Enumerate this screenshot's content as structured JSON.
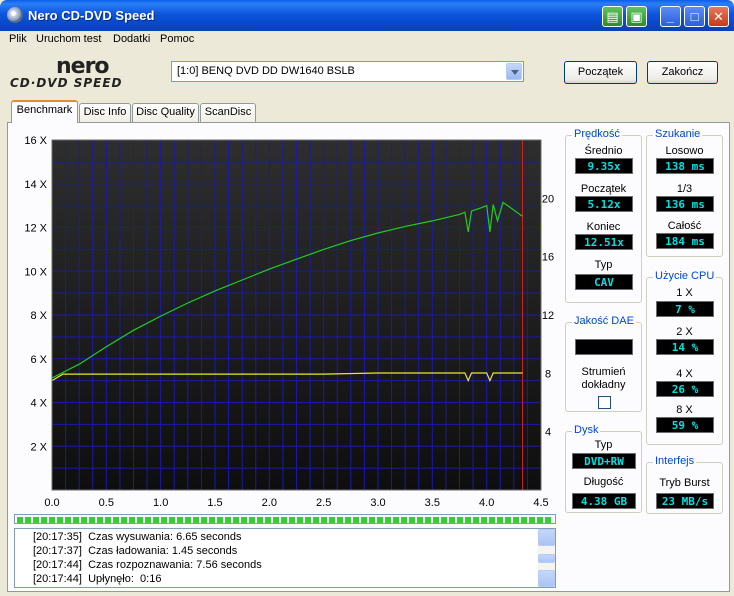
{
  "window": {
    "title": "Nero CD-DVD Speed"
  },
  "menu": [
    "Plik",
    "Uruchom test",
    "Dodatki",
    "Pomoc"
  ],
  "logo": {
    "brand": "nero",
    "product": "CD·DVD SPEED"
  },
  "drive": {
    "selected": "[1:0]  BENQ DVD DD DW1640 BSLB"
  },
  "buttons": {
    "start": "Początek",
    "stop": "Zakończ"
  },
  "tabs": [
    {
      "label": "Benchmark",
      "active": true
    },
    {
      "label": "Disc Info",
      "active": false
    },
    {
      "label": "Disc Quality",
      "active": false
    },
    {
      "label": "ScanDisc",
      "active": false
    }
  ],
  "speed_group": {
    "title": "Prędkość",
    "average_label": "Średnio",
    "average": "9.35x",
    "start_label": "Początek",
    "start": "5.12x",
    "end_label": "Koniec",
    "end": "12.51x",
    "type_label": "Typ",
    "type": "CAV"
  },
  "seek_group": {
    "title": "Szukanie",
    "random_label": "Losowo",
    "random": "138 ms",
    "third_label": "1/3",
    "third": "136 ms",
    "full_label": "Całość",
    "full": "184 ms"
  },
  "dae_group": {
    "title": "Jakość DAE",
    "value": "",
    "stream_label_1": "Strumień",
    "stream_label_2": "dokładny"
  },
  "cpu_group": {
    "title": "Użycie CPU",
    "rows": [
      {
        "label": "1 X",
        "value": "7 %"
      },
      {
        "label": "2 X",
        "value": "14 %"
      },
      {
        "label": "4 X",
        "value": "26 %"
      },
      {
        "label": "8 X",
        "value": "59 %"
      }
    ]
  },
  "disc_group": {
    "title": "Dysk",
    "type_label": "Typ",
    "type": "DVD+RW",
    "length_label": "Długość",
    "length": "4.38 GB"
  },
  "interface_group": {
    "title": "Interfejs",
    "burst_label": "Tryb Burst",
    "burst": "23 MB/s"
  },
  "progress": {
    "fraction": 1.0
  },
  "log": [
    {
      "time": "[20:17:35]",
      "text": "Czas wysuwania: 6.65 seconds"
    },
    {
      "time": "[20:17:37]",
      "text": "Czas ładowania: 1.45 seconds"
    },
    {
      "time": "[20:17:44]",
      "text": "Czas rozpoznawania: 7.56 seconds"
    },
    {
      "time": "[20:17:44]",
      "text": "Upłynęło:  0:16"
    }
  ],
  "colors": {
    "plot_bg_top": "#2e2e2e",
    "plot_bg_bottom": "#0e0e0e",
    "grid": "#1a1aa8",
    "speed_line": "#22cc22",
    "cpu_line": "#e8e830",
    "end_marker": "#cc2222",
    "value_text": "#00e0e0"
  },
  "chart_data": {
    "type": "line",
    "xlabel": "",
    "ylabel": "",
    "xlim": [
      0.0,
      4.5
    ],
    "ylim": [
      0,
      16
    ],
    "y2lim": [
      0,
      24
    ],
    "xticks": [
      "0.0",
      "0.5",
      "1.0",
      "1.5",
      "2.0",
      "2.5",
      "3.0",
      "3.5",
      "4.0",
      "4.5"
    ],
    "yticks": [
      "2 X",
      "4 X",
      "6 X",
      "8 X",
      "10 X",
      "12 X",
      "16 X",
      "14 X"
    ],
    "yticks_left": [
      {
        "v": 2,
        "label": "2 X"
      },
      {
        "v": 4,
        "label": "4 X"
      },
      {
        "v": 6,
        "label": "6 X"
      },
      {
        "v": 8,
        "label": "8 X"
      },
      {
        "v": 10,
        "label": "10 X"
      },
      {
        "v": 12,
        "label": "12 X"
      },
      {
        "v": 14,
        "label": "14 X"
      },
      {
        "v": 16,
        "label": "16 X"
      }
    ],
    "yticks_right": [
      {
        "v": 4,
        "label": "4"
      },
      {
        "v": 8,
        "label": "8"
      },
      {
        "v": 12,
        "label": "12"
      },
      {
        "v": 16,
        "label": "16"
      },
      {
        "v": 20,
        "label": "20"
      }
    ],
    "grid": true,
    "end_marker_x": 4.33,
    "series": [
      {
        "x": [
          0.0,
          0.25,
          0.5,
          0.75,
          1.0,
          1.25,
          1.5,
          1.75,
          2.0,
          2.25,
          2.5,
          2.75,
          3.0,
          3.25,
          3.5,
          3.75,
          3.8,
          3.83,
          3.86,
          3.95,
          4.0,
          4.03,
          4.06,
          4.1,
          4.15,
          4.33
        ],
        "values": [
          5.12,
          5.75,
          6.55,
          7.3,
          7.95,
          8.55,
          9.1,
          9.6,
          10.1,
          10.55,
          11.0,
          11.4,
          11.75,
          12.05,
          12.3,
          12.6,
          12.7,
          11.8,
          12.75,
          12.9,
          13.0,
          11.8,
          13.05,
          12.3,
          13.15,
          12.51
        ]
      },
      {
        "x": [
          0.0,
          0.1,
          0.5,
          1.0,
          1.5,
          2.0,
          2.5,
          3.0,
          3.5,
          3.8,
          3.83,
          3.86,
          4.0,
          4.03,
          4.06,
          4.33
        ],
        "values": [
          5.0,
          5.3,
          5.3,
          5.3,
          5.3,
          5.3,
          5.3,
          5.35,
          5.35,
          5.35,
          5.0,
          5.35,
          5.35,
          5.0,
          5.35,
          5.35
        ]
      }
    ]
  }
}
